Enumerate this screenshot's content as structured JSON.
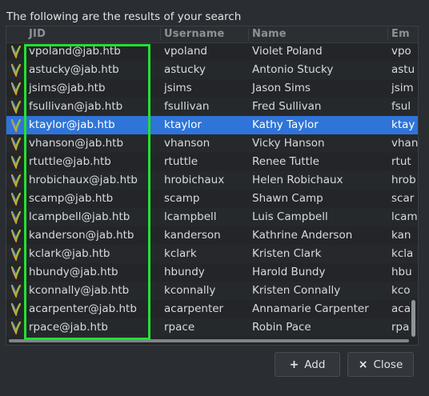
{
  "dialog": {
    "heading": "The following are the results of your search",
    "buttons": {
      "add_label": "Add",
      "add_icon": "+",
      "close_label": "Close",
      "close_icon": "×"
    }
  },
  "table": {
    "columns": [
      "JID",
      "Username",
      "Name",
      "Em"
    ],
    "selected_row": 4,
    "rows": [
      {
        "jid": "vpoland@jab.htb",
        "username": "vpoland",
        "name": "Violet Poland",
        "email": "vpo"
      },
      {
        "jid": "astucky@jab.htb",
        "username": "astucky",
        "name": "Antonio Stucky",
        "email": "astu"
      },
      {
        "jid": "jsims@jab.htb",
        "username": "jsims",
        "name": "Jason Sims",
        "email": "jsim"
      },
      {
        "jid": "fsullivan@jab.htb",
        "username": "fsullivan",
        "name": "Fred Sullivan",
        "email": "fsul"
      },
      {
        "jid": "ktaylor@jab.htb",
        "username": "ktaylor",
        "name": "Kathy Taylor",
        "email": "ktay"
      },
      {
        "jid": "vhanson@jab.htb",
        "username": "vhanson",
        "name": "Vicky Hanson",
        "email": "vhan"
      },
      {
        "jid": "rtuttle@jab.htb",
        "username": "rtuttle",
        "name": "Renee Tuttle",
        "email": "rtut"
      },
      {
        "jid": "hrobichaux@jab.htb",
        "username": "hrobichaux",
        "name": "Helen Robichaux",
        "email": "hrob"
      },
      {
        "jid": "scamp@jab.htb",
        "username": "scamp",
        "name": "Shawn Camp",
        "email": "scar"
      },
      {
        "jid": "lcampbell@jab.htb",
        "username": "lcampbell",
        "name": "Luis Campbell",
        "email": "lcam"
      },
      {
        "jid": "kanderson@jab.htb",
        "username": "kanderson",
        "name": "Kathrine Anderson",
        "email": "kan"
      },
      {
        "jid": "kclark@jab.htb",
        "username": "kclark",
        "name": "Kristen Clark",
        "email": "kcla"
      },
      {
        "jid": "hbundy@jab.htb",
        "username": "hbundy",
        "name": "Harold Bundy",
        "email": "hbu"
      },
      {
        "jid": "kconnally@jab.htb",
        "username": "kconnally",
        "name": "Kristen Connally",
        "email": "kco"
      },
      {
        "jid": "acarpenter@jab.htb",
        "username": "acarpenter",
        "name": "Annamarie Carpenter",
        "email": "aca"
      },
      {
        "jid": "rpace@jab.htb",
        "username": "rpace",
        "name": "Robin Pace",
        "email": "rpa"
      }
    ],
    "row_icon": "jabber-contact-icon"
  },
  "colors": {
    "selection": "#2f74d8",
    "highlight_box": "#22e030",
    "background": "#2a2d31"
  }
}
